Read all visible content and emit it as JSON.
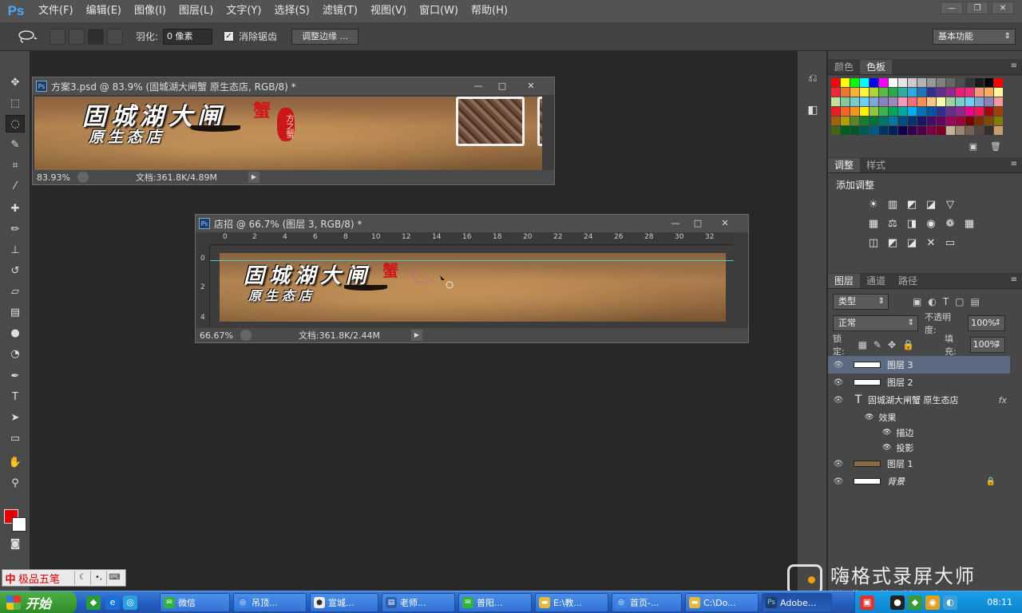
{
  "menu": {
    "logo": "Ps",
    "items": [
      "文件(F)",
      "编辑(E)",
      "图像(I)",
      "图层(L)",
      "文字(Y)",
      "选择(S)",
      "滤镜(T)",
      "视图(V)",
      "窗口(W)",
      "帮助(H)"
    ]
  },
  "options": {
    "feather_label": "羽化:",
    "feather_value": "0 像素",
    "antialias_label": "消除锯齿",
    "refine_edge_button": "调整边缘 ...",
    "workspace": "基本功能"
  },
  "doc1": {
    "title": "方案3.psd @ 83.9% (固城湖大闸蟹    原生态店, RGB/8) *",
    "zoom": "83.93%",
    "info": "文档:361.8K/4.89M",
    "brand_main": "固城湖大闸",
    "brand_sub": "原生态店",
    "seal_char": "蟹",
    "stamp_text": "方之蟹"
  },
  "doc2": {
    "title": "店招 @ 66.7% (图层 3, RGB/8) *",
    "zoom": "66.67%",
    "info": "文档:361.8K/2.44M",
    "brand_main": "固城湖大闸",
    "brand_sub": "原生态店",
    "seal_char": "蟹",
    "ruler_h": [
      "0",
      "2",
      "4",
      "6",
      "8",
      "10",
      "12",
      "14",
      "16",
      "18",
      "20",
      "22",
      "24",
      "26",
      "28",
      "30",
      "32"
    ],
    "ruler_v": [
      "0",
      "2",
      "4"
    ]
  },
  "panels": {
    "color_tabs": [
      "颜色",
      "色板"
    ],
    "adjust_tabs": [
      "调整",
      "样式"
    ],
    "adjust_title": "添加调整",
    "layer_tabs": [
      "图层",
      "通道",
      "路径"
    ],
    "filter_type": "类型",
    "blend_mode": "正常",
    "opacity_label": "不透明度:",
    "opacity_value": "100%",
    "lock_label": "锁定:",
    "fill_label": "填充:",
    "fill_value": "100%",
    "layers": [
      {
        "name": "图层 3"
      },
      {
        "name": "图层 2"
      },
      {
        "name": "固城湖大闸蟹    原生态店",
        "fx": "fx"
      },
      {
        "name": "效果"
      },
      {
        "name": "描边"
      },
      {
        "name": "投影"
      },
      {
        "name": "图层 1"
      },
      {
        "name": "背景"
      }
    ]
  },
  "ime": {
    "logo": "中",
    "name": "极品五笔"
  },
  "taskbar": {
    "start": "开始",
    "tasks": [
      "微信",
      "吊顶...",
      "宣城...",
      "老师...",
      "普阳...",
      "E:\\教...",
      "首页-...",
      "C:\\Do...",
      "Adobe..."
    ],
    "clock": "08:11"
  },
  "watermark": {
    "title": "嗨格式录屏大师",
    "url": "http://www.higeshi.com/"
  }
}
